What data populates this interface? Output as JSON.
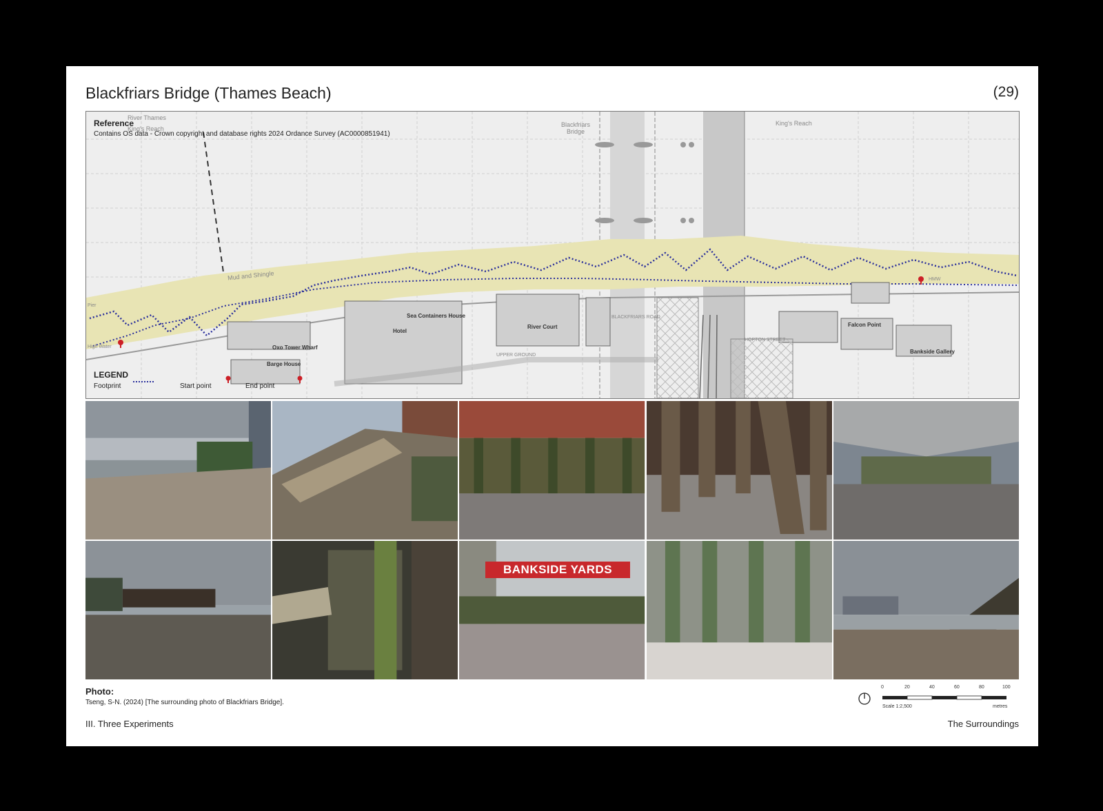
{
  "header": {
    "title": "Blackfriars Bridge (Thames Beach)",
    "page_number": "(29)"
  },
  "map": {
    "reference_title": "Reference",
    "reference_text": "Contains OS data - Crown copyright and database rights 2024 Ordance Survey (AC0000851941)",
    "legend_title": "LEGEND",
    "legend_footprint": "Footprint",
    "legend_start": "Start point",
    "legend_end": "End point",
    "labels": {
      "river_thames": "River Thames",
      "kings_reach_left": "King's Reach",
      "blackfriars_bridge": "Blackfriars Bridge",
      "kings_reach_right": "King's Reach",
      "mud_and_shingle": "Mud and Shingle",
      "sea_containers_house": "Sea Containers House",
      "hotel": "Hotel",
      "river_court": "River Court",
      "oxo_tower_wharf": "Oxo Tower Wharf",
      "barge_house": "Barge House",
      "upper_ground": "UPPER GROUND",
      "hopton_street": "HOPTON STREET",
      "falcon_point": "Falcon Point",
      "bankside_gallery": "Bankside Gallery",
      "blackfriars_road": "BLACKFRIARS ROAD",
      "high_water": "High Water",
      "pier": "Pier",
      "hmw": "HMW"
    },
    "colors": {
      "foreshore": "#e8e4b4",
      "footprint": "#2a2f9c",
      "marker": "#cc1f26"
    }
  },
  "photos": {
    "bankside_sign": "BANKSIDE YARDS",
    "label": "Photo:",
    "credit": "Tseng, S-N. (2024) [The surrounding photo of Blackfriars Bridge]."
  },
  "scale_bar": {
    "ticks": [
      "0",
      "20",
      "40",
      "60",
      "80",
      "100"
    ],
    "scale_text": "Scale 1:2,500",
    "unit": "metres"
  },
  "footer": {
    "left": "III. Three Experiments",
    "right": "The Surroundings"
  }
}
